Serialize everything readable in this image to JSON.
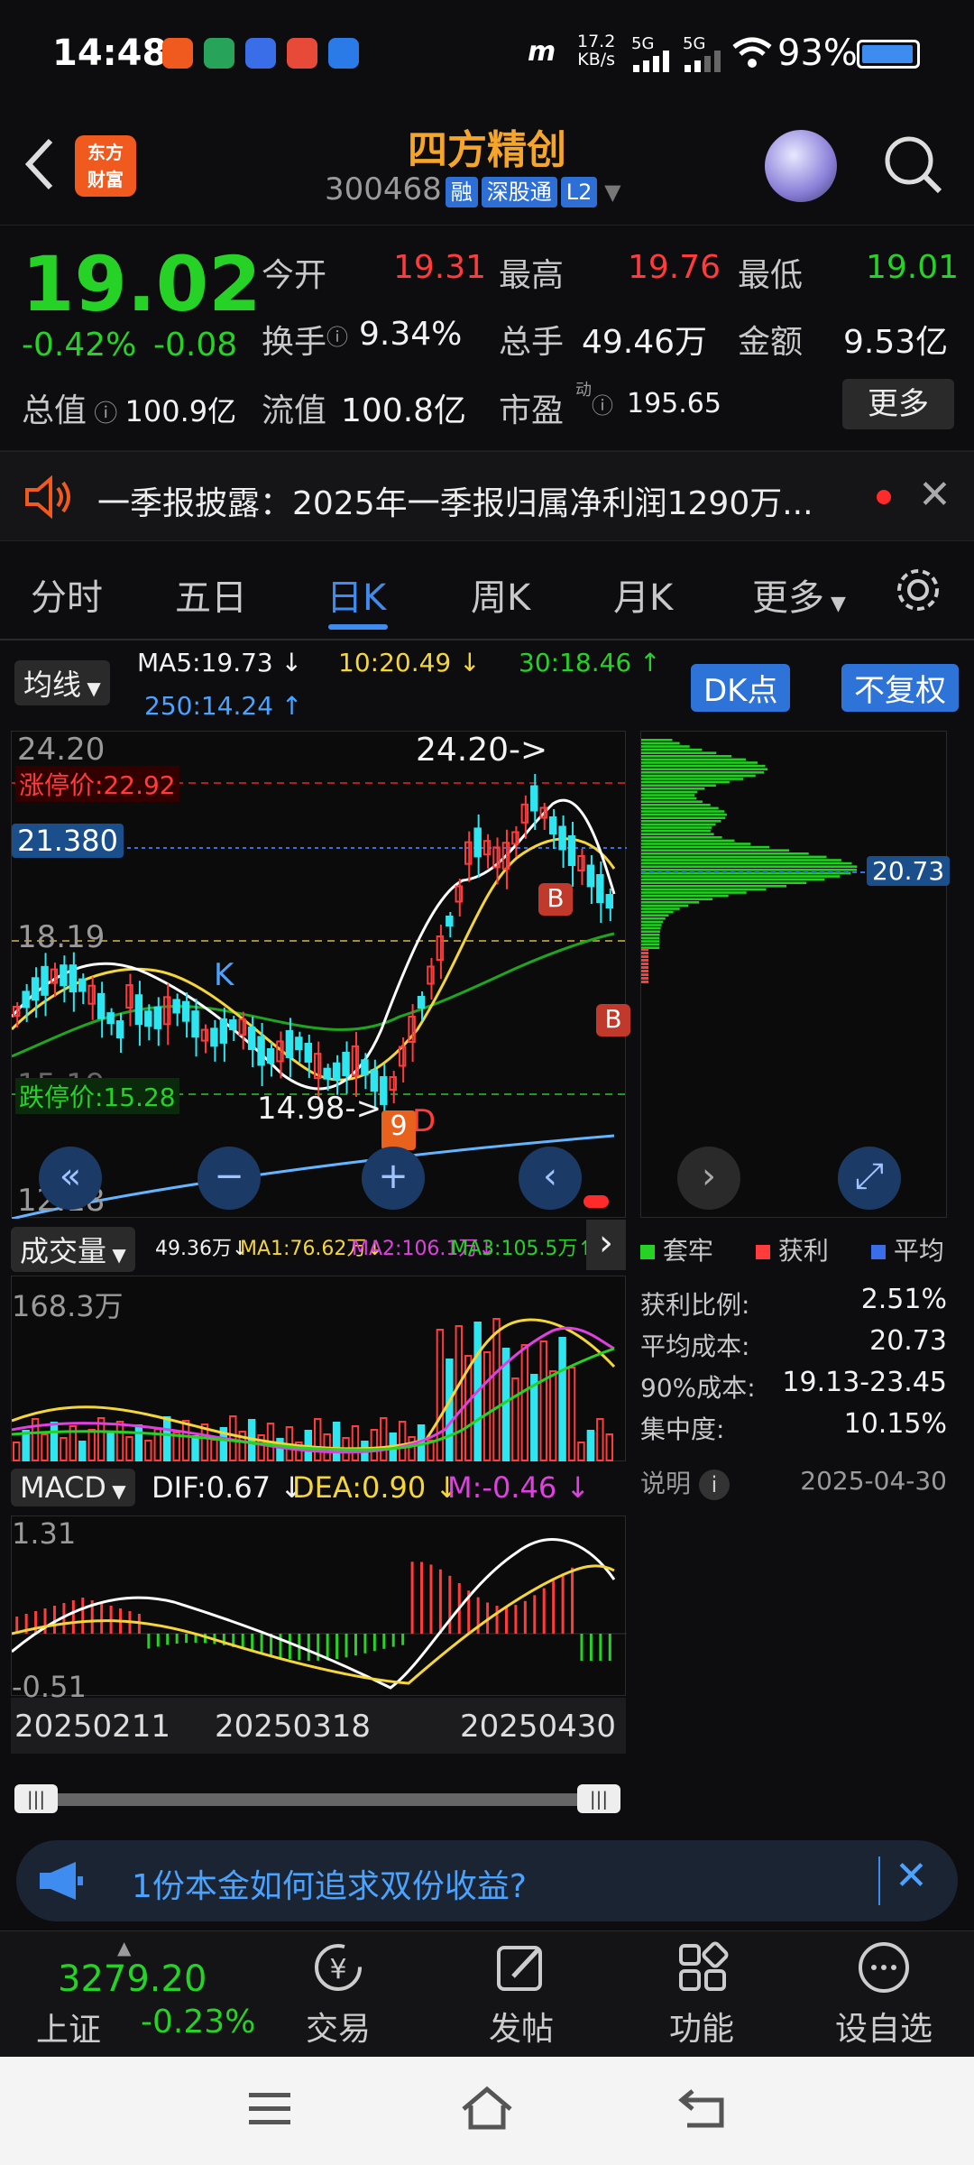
{
  "status": {
    "time": "14:48",
    "net_speed": "17.2",
    "net_unit": "KB/s",
    "sig1": "5G",
    "sig2": "5G",
    "battery": "93%"
  },
  "header": {
    "app_logo_line1": "东方",
    "app_logo_line2": "财富",
    "stock_name": "四方精创",
    "stock_code": "300468",
    "tags": [
      "融",
      "深股通",
      "L2"
    ]
  },
  "quote": {
    "price": "19.02",
    "change_pct": "-0.42%",
    "change_abs": "-0.08",
    "open_label": "今开",
    "open": "19.31",
    "high_label": "最高",
    "high": "19.76",
    "low_label": "最低",
    "low": "19.01",
    "turnover_label": "换手",
    "turnover": "9.34%",
    "volume_label": "总手",
    "volume": "49.46万",
    "amount_label": "金额",
    "amount": "9.53亿",
    "mcap_label": "总值",
    "mcap": "100.9亿",
    "float_label": "流值",
    "float": "100.8亿",
    "pe_label": "市盈",
    "pe_sup": "动",
    "pe": "195.65",
    "more": "更多"
  },
  "notice": {
    "text": "一季报披露：2025年一季报归属净利润1290万..."
  },
  "tabs": [
    "分时",
    "五日",
    "日K",
    "周K",
    "月K",
    "更多"
  ],
  "active_tab": "日K",
  "ma_bar": {
    "selector": "均线",
    "ma5": "MA5:19.73 ↓",
    "ma10": "10:20.49 ↓",
    "ma30": "30:18.46 ↑",
    "ma250": "250:14.24 ↑",
    "dk": "DK点",
    "fq": "不复权"
  },
  "kchart": {
    "price_high": "24.20",
    "limit_up": "涨停价:22.92",
    "current_tag": "21.380",
    "level_mid": "18.19",
    "level_low": "15.19",
    "limit_down": "跌停价:15.28",
    "price_low": "12.18",
    "annot_high": "24.20->",
    "annot_low": "14.98->",
    "annot_d": "D",
    "annot_k": "K",
    "annot_b": "B",
    "annot_nine": "9"
  },
  "chip": {
    "avg_tag": "20.73",
    "legend": [
      "套牢",
      "获利",
      "平均"
    ],
    "rows": [
      {
        "k": "获利比例:",
        "v": "2.51%"
      },
      {
        "k": "平均成本:",
        "v": "20.73"
      },
      {
        "k": "90%成本:",
        "v": "19.13-23.45"
      },
      {
        "k": "集中度:",
        "v": "10.15%"
      }
    ],
    "note": "说明",
    "date": "2025-04-30"
  },
  "volume": {
    "selector": "成交量",
    "v1": "49.36万↓",
    "ma1": "MA1:76.62万↓",
    "ma2": "MA2:106.1万↓",
    "ma3": "MA3:105.5万↑",
    "max": "168.3万"
  },
  "macd": {
    "selector": "MACD",
    "dif": "DIF:0.67 ↓",
    "dea": "DEA:0.90 ↓",
    "m": "M:-0.46 ↓",
    "top": "1.31",
    "bottom": "-0.51"
  },
  "dates": [
    "20250211",
    "20250318",
    "20250430"
  ],
  "ad": {
    "text": "1份本金如何追求双份收益?"
  },
  "bottom_nav": {
    "index_value": "3279.20",
    "index_name": "上证",
    "index_change": "-0.23%",
    "items": [
      "交易",
      "发帖",
      "功能",
      "设自选"
    ]
  },
  "colors": {
    "up": "#ff3b3b",
    "down": "#27d227",
    "accent": "#3e8cf0",
    "brand": "#f05a1e"
  }
}
